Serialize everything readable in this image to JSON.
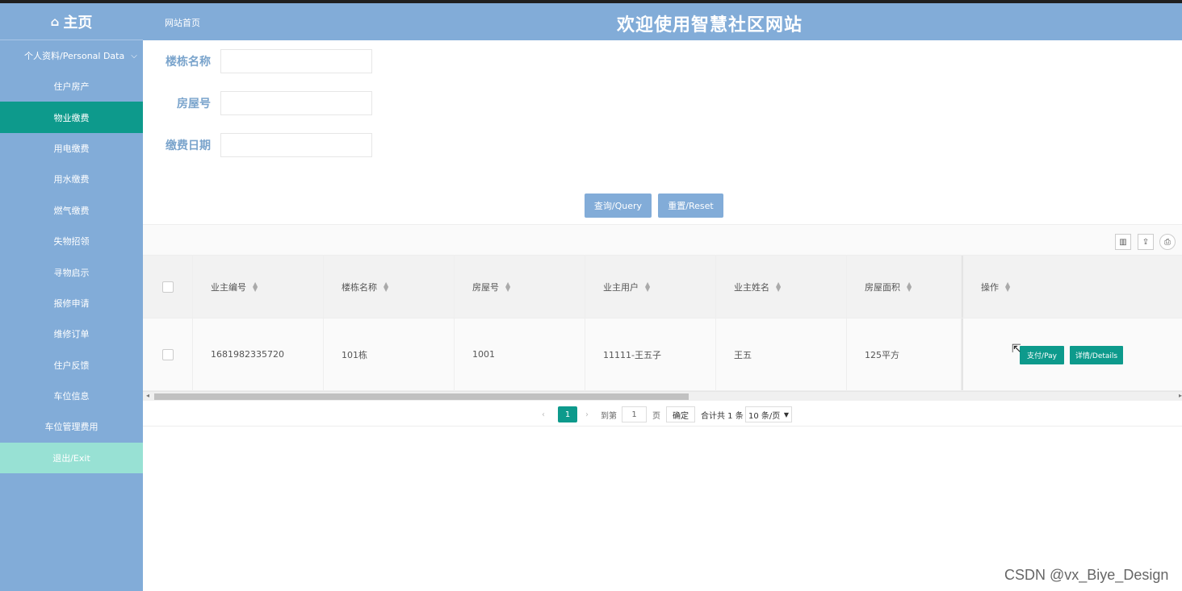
{
  "header": {
    "logo_icon": "home-icon",
    "logo_text": "主页",
    "breadcrumb": "网站首页",
    "site_title": "欢迎使用智慧社区网站"
  },
  "sidebar": {
    "group_label": "个人资料/Personal Data",
    "group_icon": "chevron-down-icon",
    "items": [
      {
        "label": "住户房产"
      },
      {
        "label": "物业缴费",
        "active": true
      },
      {
        "label": "用电缴费"
      },
      {
        "label": "用水缴费"
      },
      {
        "label": "燃气缴费"
      },
      {
        "label": "失物招领"
      },
      {
        "label": "寻物启示"
      },
      {
        "label": "报修申请"
      },
      {
        "label": "维修订单"
      },
      {
        "label": "住户反馈"
      },
      {
        "label": "车位信息"
      },
      {
        "label": "车位管理费用"
      }
    ],
    "exit_label": "退出/Exit"
  },
  "search_form": {
    "fields": [
      {
        "label": "楼栋名称",
        "value": ""
      },
      {
        "label": "房屋号",
        "value": ""
      },
      {
        "label": "缴费日期",
        "value": ""
      }
    ],
    "query_label": "查询/Query",
    "reset_label": "重置/Reset"
  },
  "toolbar": {
    "icons": [
      "columns-filter-icon",
      "export-icon",
      "print-icon"
    ]
  },
  "table": {
    "columns": [
      "业主编号",
      "楼栋名称",
      "房屋号",
      "业主用户",
      "业主姓名",
      "房屋面积",
      "操作"
    ],
    "rows": [
      {
        "cells": [
          "1681982335720",
          "101栋",
          "1001",
          "11111-王五子",
          "王五",
          "125平方"
        ],
        "actions": [
          "支付/Pay",
          "详情/Details"
        ]
      }
    ]
  },
  "pagination": {
    "current_page": "1",
    "goto_prefix": "到第",
    "goto_value": "1",
    "goto_suffix": "页",
    "confirm_label": "确定",
    "total_text": "合计共 1 条",
    "page_size": "10 条/页"
  },
  "watermark": "CSDN @vx_Biye_Design",
  "colors": {
    "header_bg": "#82acd8",
    "accent": "#0d9a8c",
    "exit_bg": "#98e1d4",
    "label_color": "#7aa4cc"
  }
}
